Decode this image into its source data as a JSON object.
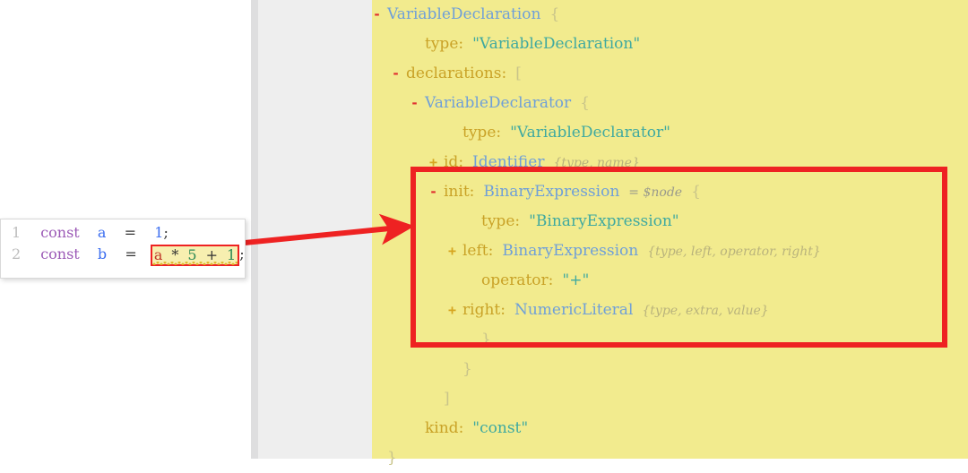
{
  "editor": {
    "name": "code-editor",
    "lines": [
      {
        "number": "1",
        "keyword": "const",
        "identifier": "a",
        "equals": "=",
        "value": "1",
        "semicolon": ";"
      },
      {
        "number": "2",
        "keyword": "const",
        "identifier": "b",
        "equals": "=",
        "semicolon": ";",
        "highlighted_expression": {
          "text": "a * 5 + 1",
          "tokens": [
            "a",
            "*",
            "5",
            "+",
            "1"
          ]
        }
      }
    ]
  },
  "ast": {
    "title": "VariableDeclaration",
    "lines": [
      {
        "toggle": "-",
        "toggle_type": "minus",
        "indent": 0,
        "node": "VariableDeclaration",
        "brace": "{"
      },
      {
        "toggle": "",
        "toggle_type": "none",
        "indent": 2,
        "key": "type:",
        "string": "\"VariableDeclaration\""
      },
      {
        "toggle": "-",
        "toggle_type": "minus",
        "indent": 1,
        "key": "declarations:",
        "brace": "["
      },
      {
        "toggle": "-",
        "toggle_type": "minus",
        "indent": 2,
        "node": "VariableDeclarator",
        "brace": "{"
      },
      {
        "toggle": "",
        "toggle_type": "none",
        "indent": 4,
        "key": "type:",
        "string": "\"VariableDeclarator\""
      },
      {
        "toggle": "+",
        "toggle_type": "plus",
        "indent": 3,
        "key": "id:",
        "node": "Identifier",
        "shape": "{type, name}"
      },
      {
        "toggle": "-",
        "toggle_type": "minus",
        "indent": 3,
        "key": "init:",
        "node": "BinaryExpression",
        "annotation": "= $node",
        "brace": "{"
      },
      {
        "toggle": "",
        "toggle_type": "none",
        "indent": 5,
        "key": "type:",
        "string": "\"BinaryExpression\""
      },
      {
        "toggle": "+",
        "toggle_type": "plus",
        "indent": 4,
        "key": "left:",
        "node": "BinaryExpression",
        "shape": "{type, left, operator, right}"
      },
      {
        "toggle": "",
        "toggle_type": "none",
        "indent": 5,
        "key": "operator:",
        "string": "\"+\""
      },
      {
        "toggle": "+",
        "toggle_type": "plus",
        "indent": 4,
        "key": "right:",
        "node": "NumericLiteral",
        "shape": "{type, extra, value}"
      },
      {
        "toggle": "",
        "toggle_type": "none",
        "indent": 5,
        "brace": "}"
      },
      {
        "toggle": "",
        "toggle_type": "none",
        "indent": 4,
        "brace": "}"
      },
      {
        "toggle": "",
        "toggle_type": "none",
        "indent": 3,
        "brace": "]"
      },
      {
        "toggle": "",
        "toggle_type": "none",
        "indent": 2,
        "key": "kind:",
        "string": "\"const\""
      },
      {
        "toggle": "",
        "toggle_type": "none",
        "indent": 0,
        "brace": "}"
      }
    ]
  },
  "annotations": {
    "highlight_box_name": "init-subtree-highlight",
    "arrow_name": "callout-arrow"
  },
  "colors": {
    "panel_yellow": "#f2eb8e",
    "panel_gray": "#eeeeee",
    "callout_red": "#ee2222",
    "node_type_blue": "#6f9fd8",
    "key_gold": "#c9a227",
    "string_teal": "#3fa9a0",
    "toggle_red": "#e03030"
  }
}
